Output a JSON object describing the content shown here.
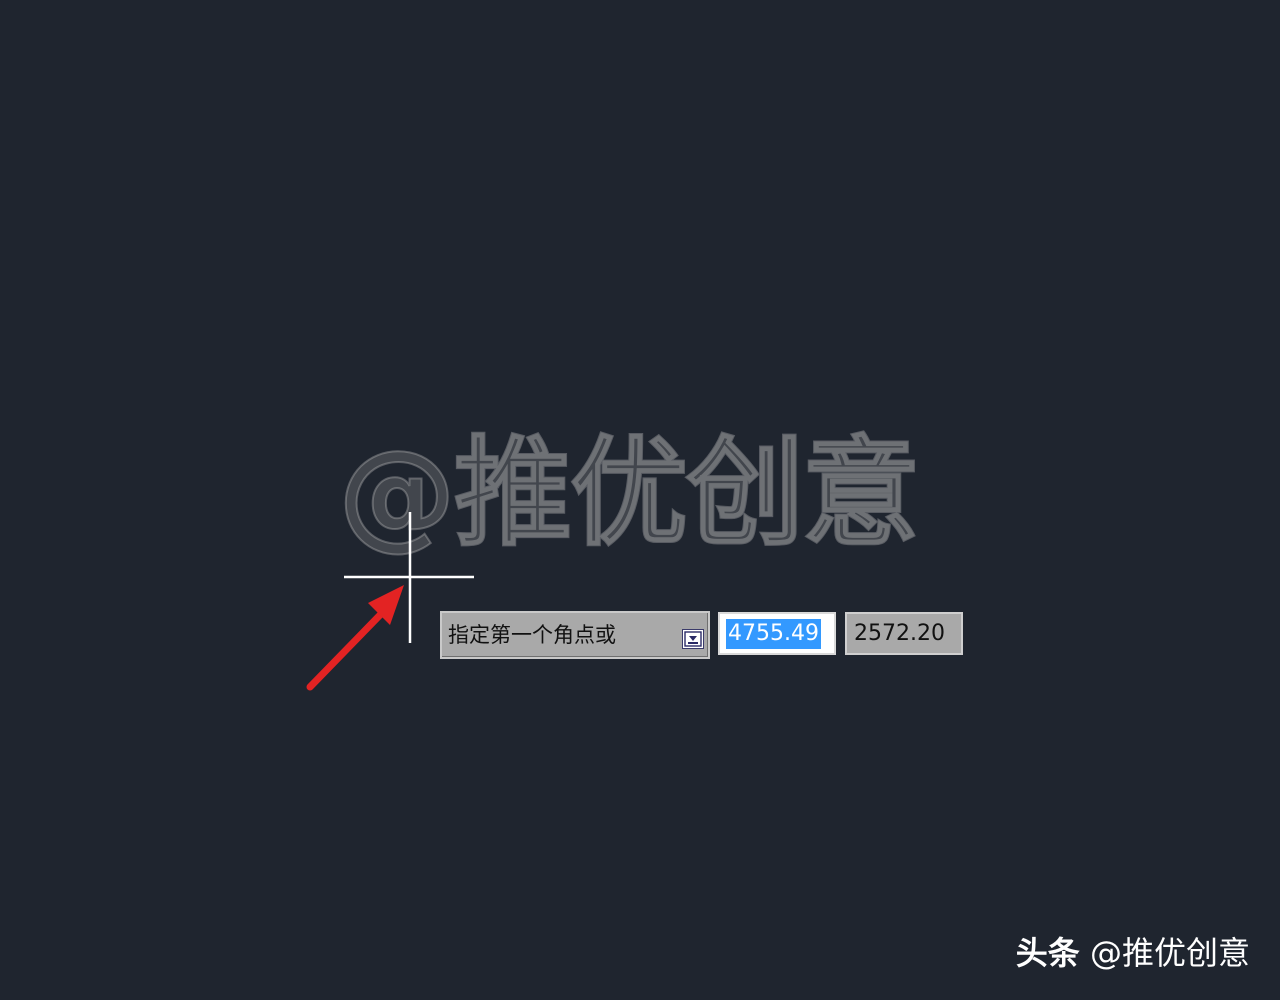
{
  "watermark": "@推优创意",
  "dynamic_input": {
    "prompt": "指定第一个角点或",
    "options_icon": "dropdown-arrow-icon",
    "x_value": "4755.49",
    "y_value": "2572.20"
  },
  "credit": {
    "brand": "头条",
    "handle": "@推优创意"
  },
  "colors": {
    "background": "#1f252f",
    "arrow": "#e32323",
    "selection": "#3399ff",
    "crosshair": "#ffffff"
  },
  "icons": {
    "cursor": "crosshair-cursor-icon",
    "annotation": "red-arrow-icon"
  }
}
